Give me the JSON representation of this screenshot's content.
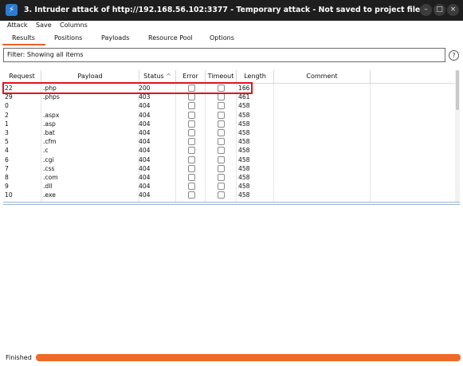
{
  "window": {
    "title": "3. Intruder attack of http://192.168.56.102:3377 - Temporary attack - Not saved to project file",
    "app_icon": "burp-lightning-icon",
    "controls": [
      "minimize-icon",
      "maximize-icon",
      "close-icon"
    ]
  },
  "menu": [
    "Attack",
    "Save",
    "Columns"
  ],
  "tabs": [
    "Results",
    "Positions",
    "Payloads",
    "Resource Pool",
    "Options"
  ],
  "active_tab": "Results",
  "filter": {
    "text": "Filter: Showing all items",
    "help_icon": "help-icon"
  },
  "table": {
    "headers": [
      "Request",
      "Payload",
      "Status",
      "Error",
      "Timeout",
      "Length",
      "Comment"
    ],
    "sort_indicator": "^",
    "rows": [
      {
        "request": "22",
        "payload": ".php",
        "status": "200",
        "error": false,
        "timeout": false,
        "length": "166"
      },
      {
        "request": "29",
        "payload": ".phps",
        "status": "403",
        "error": false,
        "timeout": false,
        "length": "461"
      },
      {
        "request": "0",
        "payload": "",
        "status": "404",
        "error": false,
        "timeout": false,
        "length": "458"
      },
      {
        "request": "2",
        "payload": ".aspx",
        "status": "404",
        "error": false,
        "timeout": false,
        "length": "458"
      },
      {
        "request": "1",
        "payload": ".asp",
        "status": "404",
        "error": false,
        "timeout": false,
        "length": "458"
      },
      {
        "request": "3",
        "payload": ".bat",
        "status": "404",
        "error": false,
        "timeout": false,
        "length": "458"
      },
      {
        "request": "5",
        "payload": ".cfm",
        "status": "404",
        "error": false,
        "timeout": false,
        "length": "458"
      },
      {
        "request": "4",
        "payload": ".c",
        "status": "404",
        "error": false,
        "timeout": false,
        "length": "458"
      },
      {
        "request": "6",
        "payload": ".cgi",
        "status": "404",
        "error": false,
        "timeout": false,
        "length": "458"
      },
      {
        "request": "7",
        "payload": ".css",
        "status": "404",
        "error": false,
        "timeout": false,
        "length": "458"
      },
      {
        "request": "8",
        "payload": ".com",
        "status": "404",
        "error": false,
        "timeout": false,
        "length": "458"
      },
      {
        "request": "9",
        "payload": ".dll",
        "status": "404",
        "error": false,
        "timeout": false,
        "length": "458"
      },
      {
        "request": "10",
        "payload": ".exe",
        "status": "404",
        "error": false,
        "timeout": false,
        "length": "458"
      }
    ]
  },
  "status": {
    "text": "Finished",
    "progress": 1.0
  },
  "colors": {
    "accent": "#ef6a27",
    "highlight": "#e0141e",
    "titlebar": "#1e1e1e"
  }
}
